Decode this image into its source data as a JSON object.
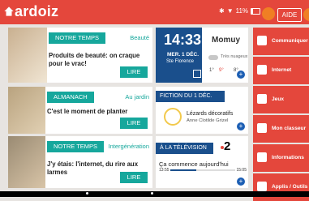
{
  "brand": "ardoiz",
  "status": {
    "battery": "11%",
    "battery_label": "11%"
  },
  "header": {
    "help_label": "AIDE"
  },
  "cards": [
    {
      "tag": "NOTRE TEMPS",
      "tag_color": "#16a79c",
      "category": "Beauté",
      "category_color": "#16a79c",
      "headline": "Produits de beauté: on craque pour le vrac!",
      "read_label": "LIRE"
    },
    {
      "tag": "ALMANACH",
      "tag_color": "#16a79c",
      "category": "Au jardin",
      "category_color": "#16a79c",
      "headline": "C'est le moment de planter",
      "read_label": "LIRE"
    },
    {
      "tag": "NOTRE TEMPS",
      "tag_color": "#16a79c",
      "category": "Intergénération",
      "category_color": "#16a79c",
      "headline": "J'y étais: l'internet, du rire aux larmes",
      "read_label": "LIRE"
    }
  ],
  "weather": {
    "time": "14:33",
    "date": "MER. 1 DÉC.",
    "saint": "Ste Florence",
    "city": "Momuy",
    "desc": "Très nuageux",
    "temps": [
      "1°",
      "9°",
      "8°"
    ]
  },
  "fiction": {
    "tag": "FICTION DU 1 DÉC.",
    "title": "Lézards décoratifs",
    "author": "Anne Clotilde Grizel"
  },
  "tv": {
    "tag": "À LA TÉLÉVISION",
    "channel": "2",
    "title": "Ça commence aujourd'hui",
    "start": "13:55",
    "end": "15:05",
    "progress": 0.4
  },
  "menu": [
    {
      "label": "Communiquer",
      "icon": "mail-icon"
    },
    {
      "label": "Internet",
      "icon": "globe-icon"
    },
    {
      "label": "Jeux",
      "icon": "dice-icon"
    },
    {
      "label": "Mon classeur",
      "icon": "folder-icon"
    },
    {
      "label": "Informations",
      "icon": "news-icon"
    },
    {
      "label": "Applis / Outils",
      "icon": "tools-icon"
    }
  ],
  "colors": {
    "accent": "#e4473c",
    "navy": "#1a4f8c",
    "teal": "#16a79c"
  }
}
